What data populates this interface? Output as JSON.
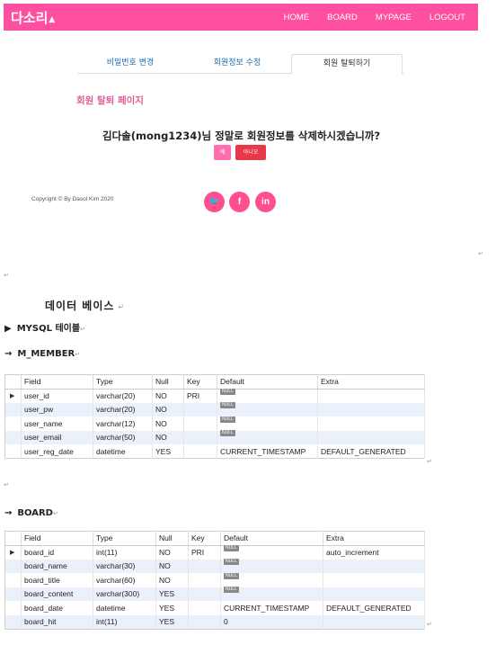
{
  "nav": {
    "logo": "다소리",
    "links": [
      "HOME",
      "BOARD",
      "MYPAGE",
      "LOGOUT"
    ]
  },
  "tabs": [
    "비밀번호 변경",
    "회원정보 수정",
    "회원 탈퇴하기"
  ],
  "withdraw": {
    "title": "회원 탈퇴 페이지",
    "question": "김다솔(mong1234)님 정말로 회원정보를 삭제하시겠습니까?",
    "yes_label": "예",
    "no_label": "아니오"
  },
  "footer": {
    "copyright": "Copyright © By Dasol Kim 2020",
    "social": [
      "twitter-icon",
      "facebook-icon",
      "linkedin-icon"
    ],
    "social_glyphs": [
      "🐦",
      "f",
      "in"
    ]
  },
  "doc": {
    "para_mark": "↵",
    "db_title": "데이터 베이스",
    "mysql_line": "MYSQL 테이블",
    "mysql_marker": "▶",
    "arrow": "→",
    "member_title": "M_MEMBER",
    "board_title": "BOARD",
    "null_label": "NULL",
    "row_marker": "▶"
  },
  "member_table": {
    "headers": [
      "Field",
      "Type",
      "Null",
      "Key",
      "Default",
      "Extra"
    ],
    "rows": [
      [
        "user_id",
        "varchar(20)",
        "NO",
        "PRI",
        "NULL",
        ""
      ],
      [
        "user_pw",
        "varchar(20)",
        "NO",
        "",
        "NULL",
        ""
      ],
      [
        "user_name",
        "varchar(12)",
        "NO",
        "",
        "NULL",
        ""
      ],
      [
        "user_email",
        "varchar(50)",
        "NO",
        "",
        "NULL",
        ""
      ],
      [
        "user_reg_date",
        "datetime",
        "YES",
        "",
        "CURRENT_TIMESTAMP",
        "DEFAULT_GENERATED"
      ]
    ]
  },
  "board_table": {
    "headers": [
      "Field",
      "Type",
      "Null",
      "Key",
      "Default",
      "Extra"
    ],
    "rows": [
      [
        "board_id",
        "int(11)",
        "NO",
        "PRI",
        "NULL",
        "auto_increment"
      ],
      [
        "board_name",
        "varchar(30)",
        "NO",
        "",
        "NULL",
        ""
      ],
      [
        "board_title",
        "varchar(60)",
        "NO",
        "",
        "NULL",
        ""
      ],
      [
        "board_content",
        "varchar(300)",
        "YES",
        "",
        "NULL",
        ""
      ],
      [
        "board_date",
        "datetime",
        "YES",
        "",
        "CURRENT_TIMESTAMP",
        "DEFAULT_GENERATED"
      ],
      [
        "board_hit",
        "int(11)",
        "YES",
        "",
        "0",
        ""
      ]
    ]
  }
}
